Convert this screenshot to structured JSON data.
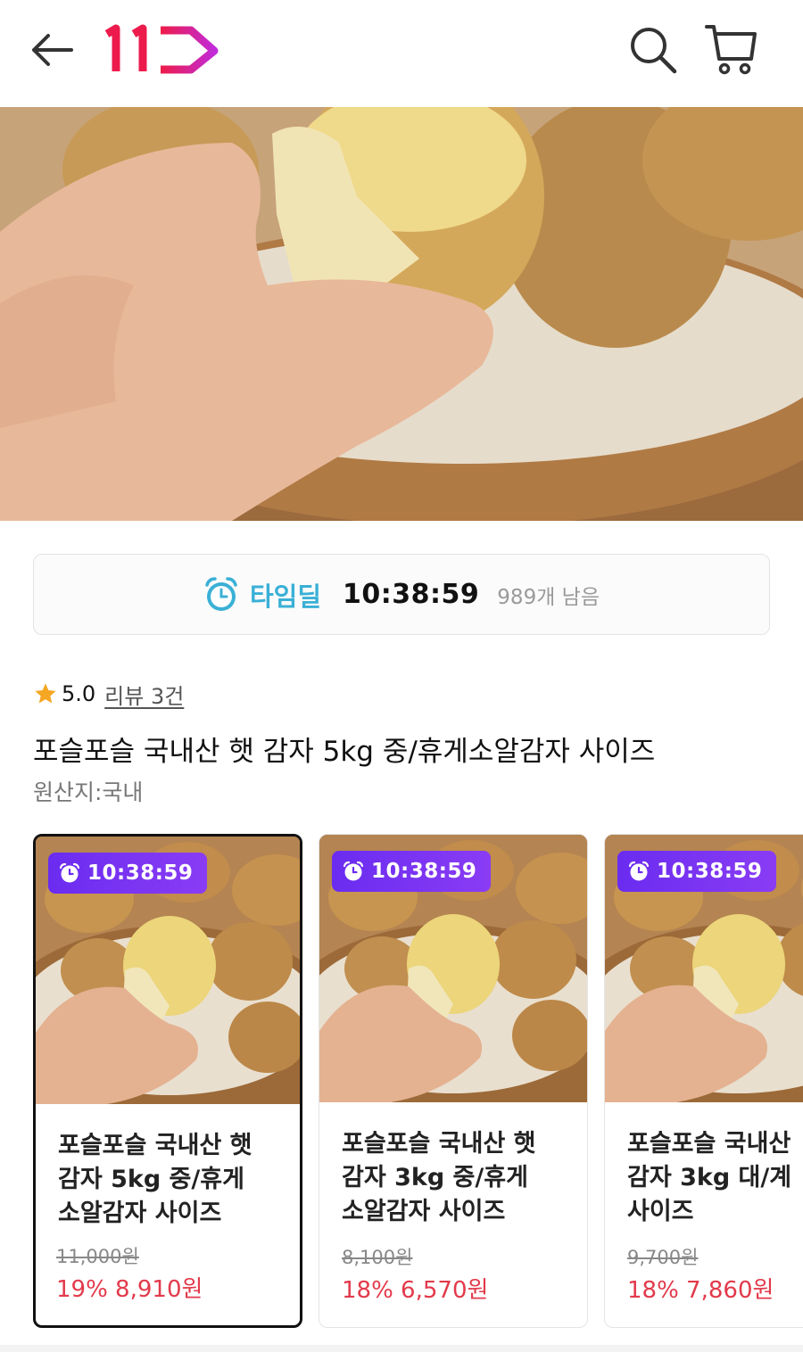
{
  "header": {
    "logo_text": "11",
    "accent": "#ec1b4c"
  },
  "hero": {
    "alt": "potato"
  },
  "timedeal": {
    "label": "타임딜",
    "time": "10:38:59",
    "remaining": "989개 남음",
    "accent": "#3ab0d6"
  },
  "rating": {
    "score": "5.0",
    "review_label": "리뷰 3건",
    "star_color": "#f5a623"
  },
  "product": {
    "title": "포슬포슬 국내산 햇 감자 5kg 중/휴게소알감자 사이즈",
    "origin": "원산지:국내"
  },
  "options": [
    {
      "time": "10:38:59",
      "name": "포슬포슬 국내산 햇\n감자 5kg 중/휴게\n소알감자 사이즈",
      "original_price": "11,000원",
      "price": "19% 8,910원",
      "selected": true
    },
    {
      "time": "10:38:59",
      "name": "포슬포슬 국내산 햇\n감자 3kg 중/휴게\n소알감자 사이즈",
      "original_price": "8,100원",
      "price": "18% 6,570원",
      "selected": false
    },
    {
      "time": "10:38:59",
      "name": "포슬포슬 국내산\n감자 3kg 대/계\n사이즈",
      "original_price": "9,700원",
      "price": "18% 7,860원",
      "selected": false
    }
  ]
}
